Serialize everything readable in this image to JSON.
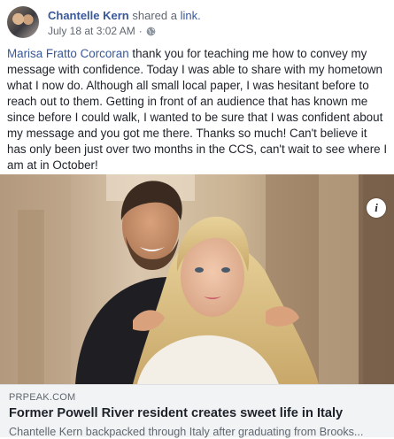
{
  "post": {
    "author": "Chantelle Kern",
    "action_text": "shared a",
    "link_word": "link.",
    "timestamp": "July 18 at 3:02 AM",
    "privacy_icon": "globe-icon",
    "mention": "Marisa Fratto Corcoran",
    "body": " thank you for teaching me how to convey my message with confidence. Today I was able to share with my hometown what I now do. Although all small local paper, I was hesitant before to reach out to them. Getting in front of an audience that has known me since before I could walk, I wanted to be sure that I was confident about my message and you got me there. Thanks so much! Can't believe it has only been just over two months in the CCS, can't wait to see where I am at in October!"
  },
  "link_preview": {
    "info_icon": "info-icon",
    "domain": "PRPEAK.COM",
    "title": "Former Powell River resident creates sweet life in Italy",
    "description": "Chantelle Kern backpacked through Italy after graduating from Brooks..."
  },
  "colors": {
    "link_blue": "#385898",
    "meta_gray": "#606770",
    "footer_bg": "#f2f3f5"
  }
}
